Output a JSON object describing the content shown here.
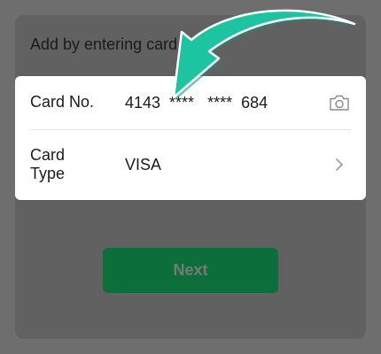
{
  "section": {
    "title": "Add by entering card"
  },
  "card_form": {
    "card_no": {
      "label": "Card No.",
      "value": "4143  ****   ****  684",
      "icon": "camera-icon"
    },
    "card_type": {
      "label": "Card Type",
      "value": "VISA",
      "icon": "chevron-right-icon"
    }
  },
  "actions": {
    "next_label": "Next"
  },
  "colors": {
    "overlay": "#6e6e6e",
    "button": "#0c6e3a",
    "arrow": "#1dc4a2"
  }
}
